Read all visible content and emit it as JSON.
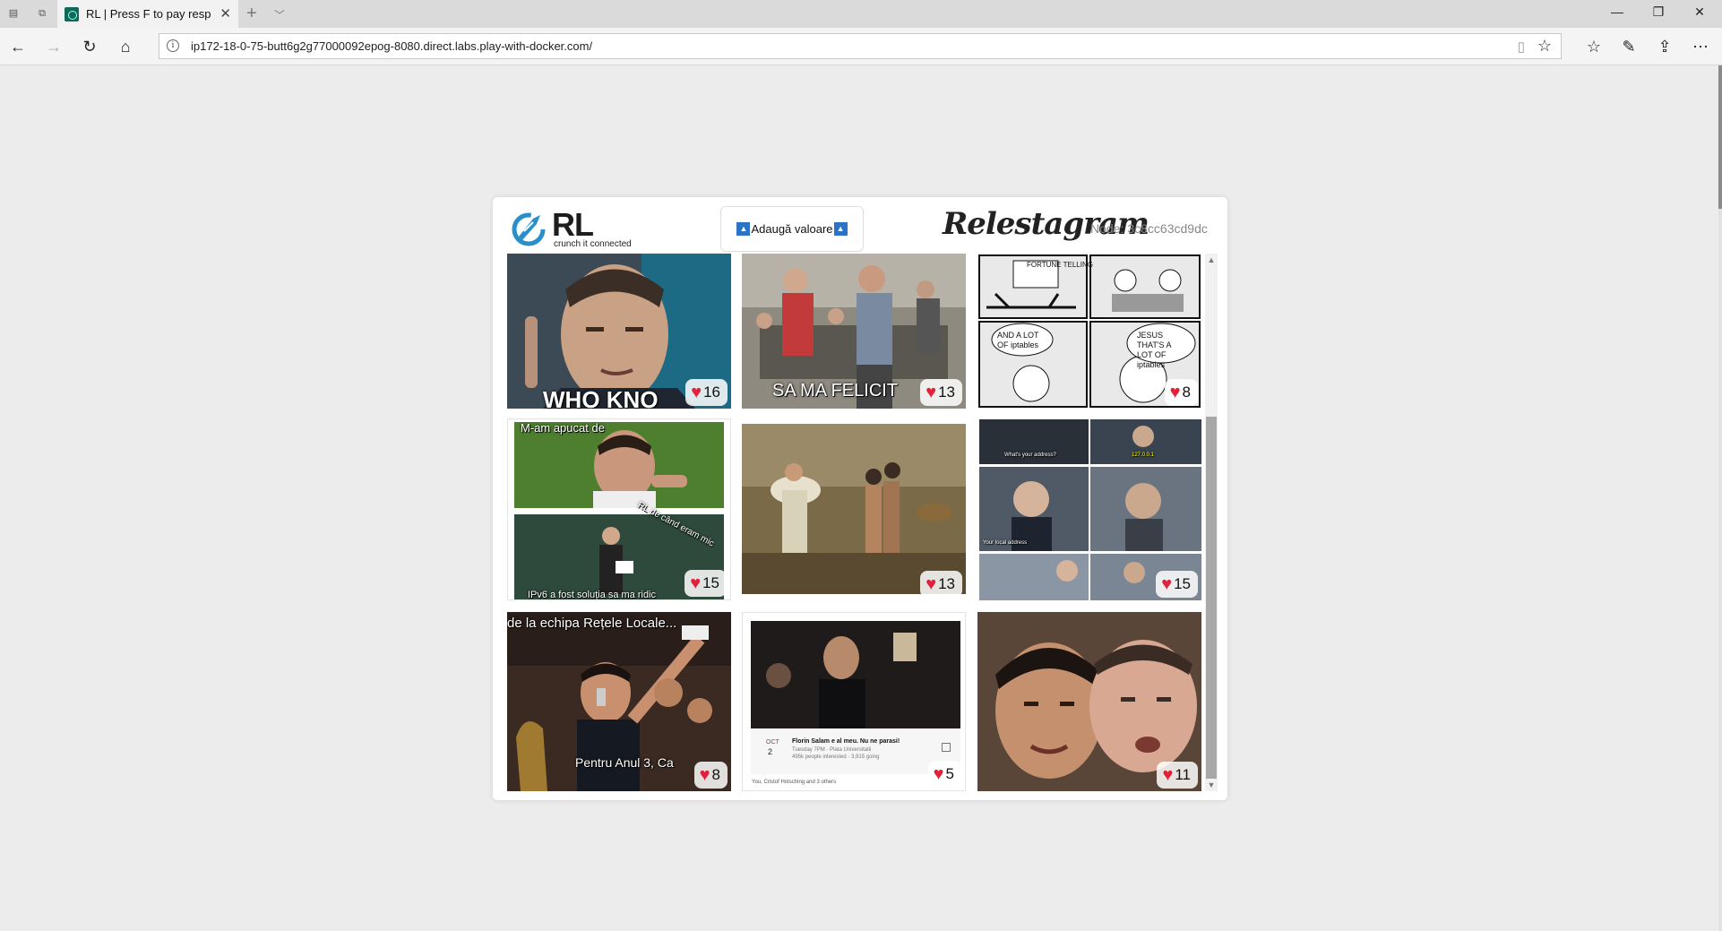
{
  "browser": {
    "tab_title": "RL | Press F to pay respe",
    "url": "ip172-18-0-75-butt6g2g77000092epog-8080.direct.labs.play-with-docker.com/"
  },
  "app": {
    "logo_text": "RL",
    "logo_subtitle": "crunch it connected",
    "add_button_label": "Adaugă valoare",
    "brand": "Relestagram",
    "node_label": "Node:",
    "node_id": "3c8cc63cd9dc"
  },
  "posts": [
    {
      "likes": "16",
      "caption": "WHO KNO"
    },
    {
      "likes": "13",
      "caption": "SA MA FELICIT"
    },
    {
      "likes": "8",
      "caption_a": "AND A LOT OF iptables",
      "caption_b": "JESUS THAT'S A LOT OF iptables",
      "sign": "FORTUNE TELLING"
    },
    {
      "likes": "15",
      "caption_a": "M-am apucat de",
      "caption_b": "RL de când eram mic",
      "caption_c": "IPv6 a fost soluția sa ma ridic"
    },
    {
      "likes": "13"
    },
    {
      "likes": "15",
      "caption_a": "What's your address?",
      "caption_b": "Your local address",
      "caption_c": "127.0.0.1"
    },
    {
      "likes": "8",
      "caption_a": "de la echipa Rețele Locale...",
      "caption_b": "Pentru Anul 3, Ca"
    },
    {
      "likes": "5",
      "event_title": "Florin Salam e al meu. Nu ne parasi!",
      "event_month": "OCT",
      "event_day": "2",
      "event_meta": "Tuesday 7PM · Plata Universitatii",
      "event_people": "495k people interested · 3,915 going",
      "event_reactions": "You, Cristof Hotsching and 3 others"
    },
    {
      "likes": "11"
    }
  ]
}
